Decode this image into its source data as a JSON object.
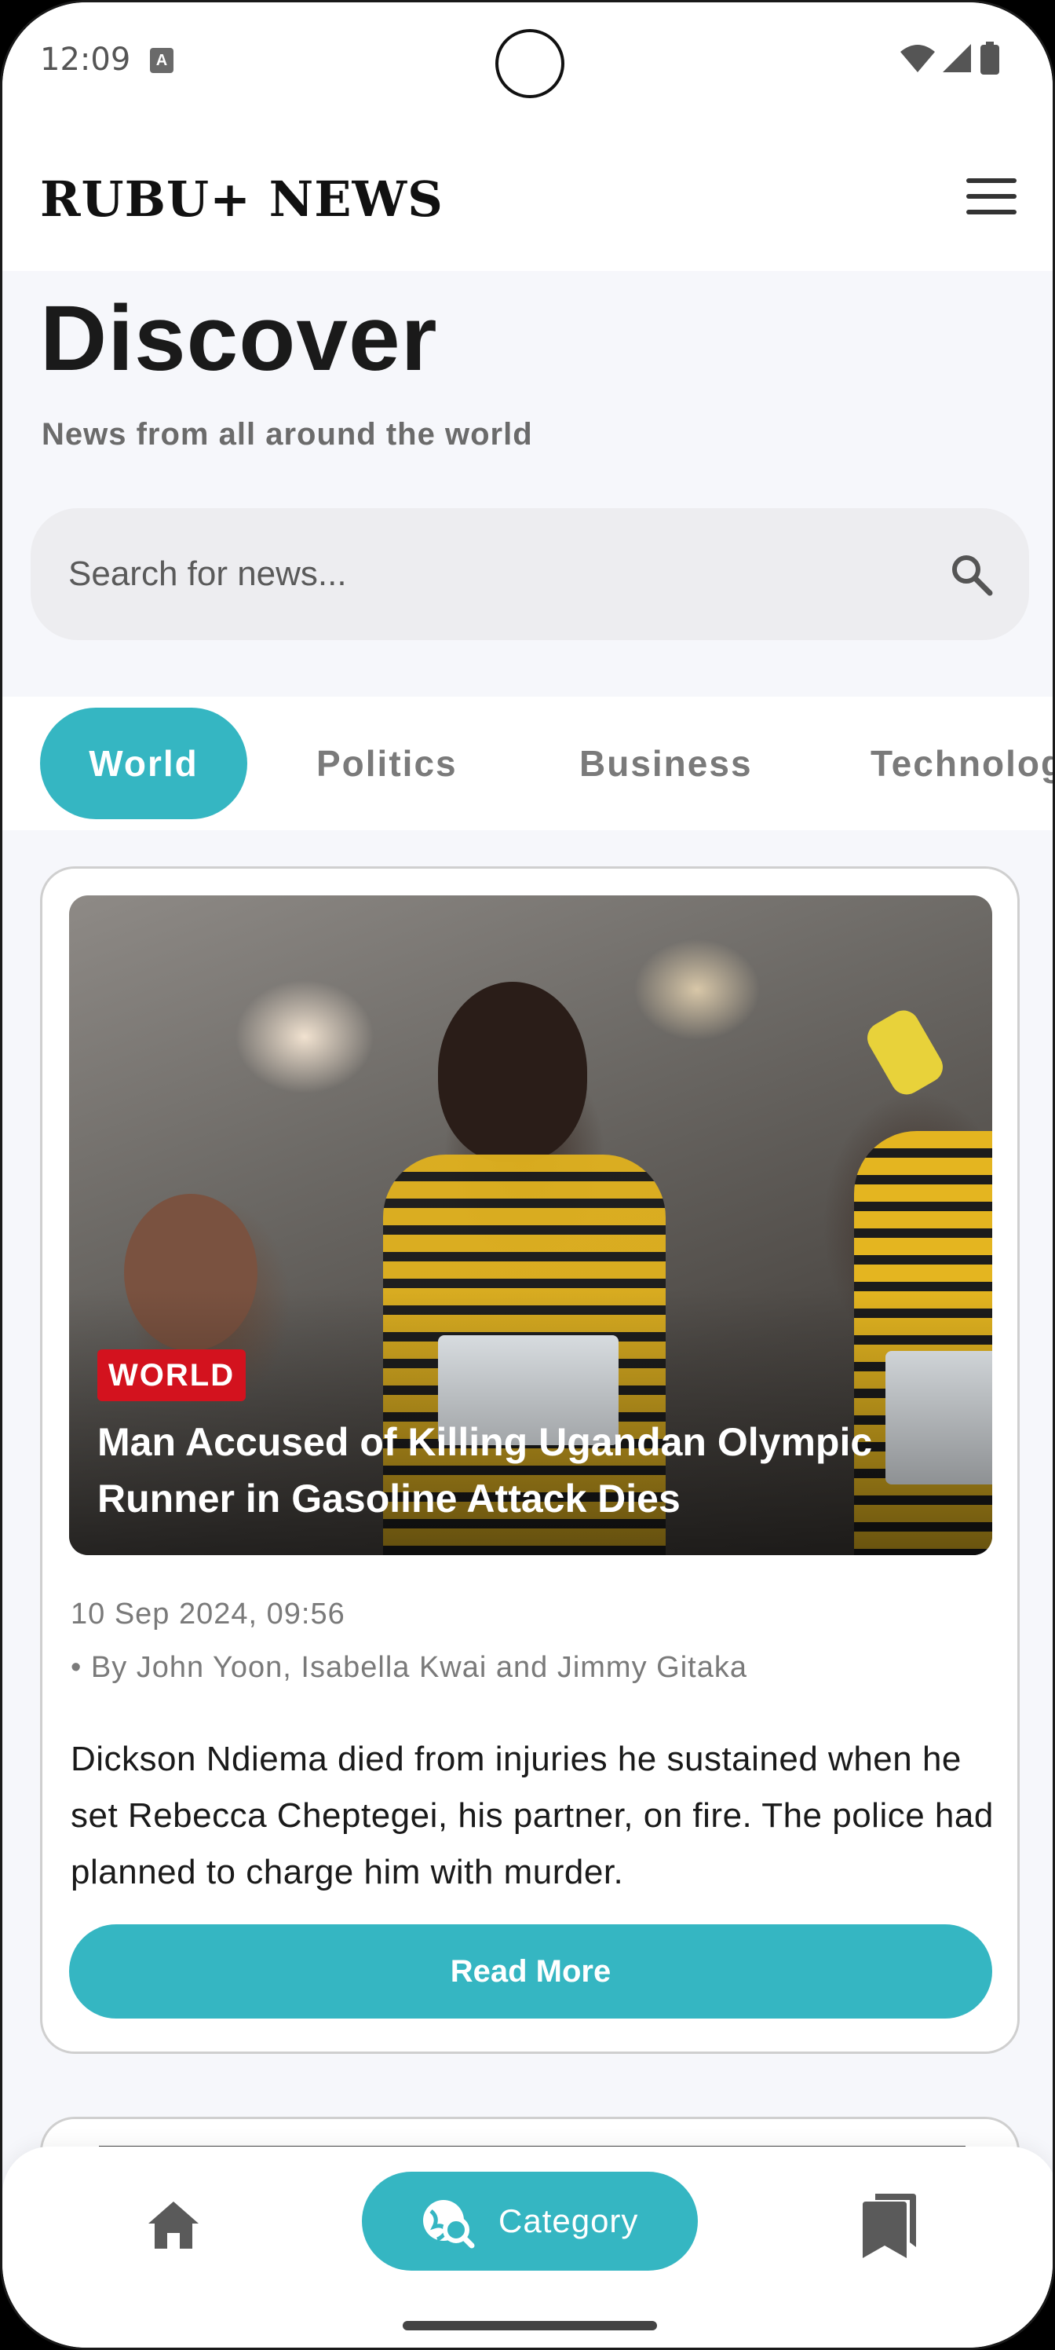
{
  "status_bar": {
    "time": "12:09",
    "sim_label": "A"
  },
  "header": {
    "brand": "RUBU+ NEWS"
  },
  "page": {
    "title": "Discover",
    "subtitle": "News from all around the world"
  },
  "search": {
    "placeholder": "Search for news..."
  },
  "tabs": [
    {
      "label": "World",
      "active": true
    },
    {
      "label": "Politics",
      "active": false
    },
    {
      "label": "Business",
      "active": false
    },
    {
      "label": "Technology",
      "active": false
    }
  ],
  "article": {
    "category": "WORLD",
    "headline": "Man Accused of Killing Ugandan Olympic Runner in Gasoline Attack Dies",
    "date": "10 Sep 2024, 09:56",
    "author": "• By John Yoon, Isabella Kwai and Jimmy Gitaka",
    "summary": "Dickson Ndiema died from injuries he sustained when he set Rebecca Cheptegei, his partner, on fire. The police had planned to charge him with murder.",
    "button": "Read More"
  },
  "bottom_nav": {
    "items": [
      {
        "icon": "home-icon",
        "label": ""
      },
      {
        "icon": "category-icon",
        "label": "Category",
        "active": true
      },
      {
        "icon": "bookmarks-icon",
        "label": ""
      }
    ]
  },
  "colors": {
    "accent": "#35b6c2",
    "badge": "#d3121e",
    "background": "#f6f7fb"
  }
}
